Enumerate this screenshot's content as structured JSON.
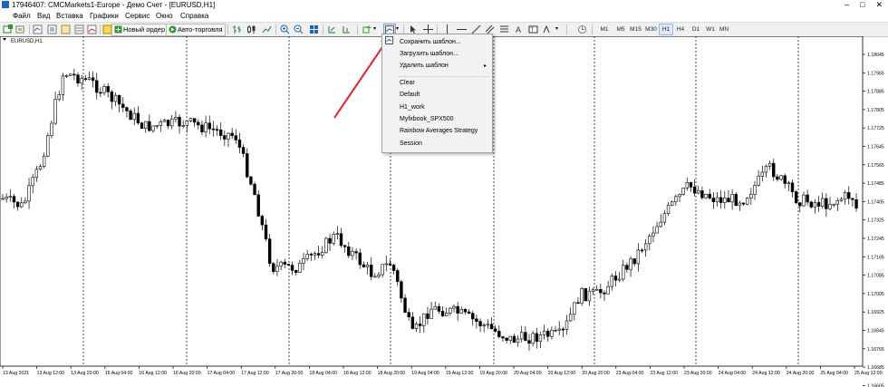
{
  "window": {
    "title": "17946407: CMCMarkets1-Europe - Демо Счет - [EURUSD,H1]",
    "controls": [
      "–",
      "□",
      "✕"
    ]
  },
  "menu": [
    "Файл",
    "Вид",
    "Вставка",
    "Графики",
    "Сервис",
    "Окно",
    "Справка"
  ],
  "toolbar": {
    "new_order_label": "Новый ордер",
    "autotrading_label": "Авто-торговля",
    "timeframes": [
      "M1",
      "M5",
      "M15",
      "M30",
      "H1",
      "H4",
      "D1",
      "W1",
      "MN"
    ],
    "active_timeframe": "H1"
  },
  "template_menu": {
    "items": [
      {
        "label": "Сохранить шаблон...",
        "has_icon": true
      },
      {
        "label": "Загрузить шаблон...",
        "has_icon": false
      },
      {
        "label": "Удалить шаблон",
        "submenu": true
      },
      {
        "label": "Clear"
      },
      {
        "label": "Default"
      },
      {
        "label": "H1_work"
      },
      {
        "label": "Myfxbook_SPX500"
      },
      {
        "label": "Rainbow Averages Strategy"
      },
      {
        "label": "Session"
      }
    ]
  },
  "chart": {
    "symbol_label": "EURUSD,H1",
    "price_labels": [
      "1.18045",
      "1.17965",
      "1.17885",
      "1.17805",
      "1.17725",
      "1.17645",
      "1.17565",
      "1.17485",
      "1.17405",
      "1.17325",
      "1.17245",
      "1.17165",
      "1.17085",
      "1.17005",
      "1.16925",
      "1.16845",
      "1.16765",
      "1.16685",
      "1.16605"
    ],
    "time_labels": [
      "13 Aug 2021",
      "13 Aug 12:00",
      "13 Aug 20:00",
      "16 Aug 04:00",
      "16 Aug 12:00",
      "16 Aug 20:00",
      "17 Aug 04:00",
      "17 Aug 12:00",
      "17 Aug 20:00",
      "18 Aug 04:00",
      "18 Aug 12:00",
      "18 Aug 20:00",
      "19 Aug 04:00",
      "19 Aug 12:00",
      "19 Aug 20:00",
      "20 Aug 04:00",
      "20 Aug 12:00",
      "20 Aug 20:00",
      "23 Aug 04:00",
      "23 Aug 12:00",
      "23 Aug 20:00",
      "24 Aug 04:00",
      "24 Aug 12:00",
      "24 Aug 20:00",
      "25 Aug 04:00",
      "25 Aug 12:00"
    ],
    "annotation": "red arrow pointing to templates toolbar button",
    "colors": {
      "candle": "#000000",
      "grid": "#000000",
      "arrow": "#e8202a",
      "accent": "#1e63c8"
    }
  }
}
